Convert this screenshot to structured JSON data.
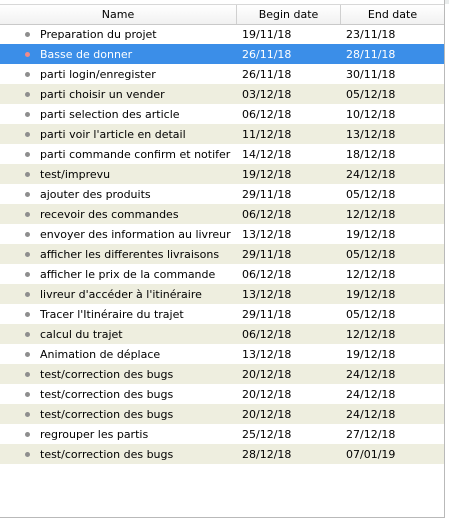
{
  "columns": {
    "name": "Name",
    "begin": "Begin date",
    "end": "End date"
  },
  "rows": [
    {
      "name": "Preparation du projet",
      "begin": "19/11/18",
      "end": "23/11/18"
    },
    {
      "name": "Basse de donner",
      "begin": "26/11/18",
      "end": "28/11/18"
    },
    {
      "name": "parti login/enregister",
      "begin": "26/11/18",
      "end": "30/11/18"
    },
    {
      "name": "parti choisir un vender",
      "begin": "03/12/18",
      "end": "05/12/18"
    },
    {
      "name": "parti selection des article",
      "begin": "06/12/18",
      "end": "10/12/18"
    },
    {
      "name": "parti voir l'article en detail",
      "begin": "11/12/18",
      "end": "13/12/18"
    },
    {
      "name": "parti commande confirm et notifer",
      "begin": "14/12/18",
      "end": "18/12/18"
    },
    {
      "name": "test/imprevu",
      "begin": "19/12/18",
      "end": "24/12/18"
    },
    {
      "name": "ajouter des produits",
      "begin": "29/11/18",
      "end": "05/12/18"
    },
    {
      "name": "recevoir des commandes",
      "begin": "06/12/18",
      "end": "12/12/18"
    },
    {
      "name": "envoyer des information au livreur",
      "begin": "13/12/18",
      "end": "19/12/18"
    },
    {
      "name": "afficher les differentes livraisons",
      "begin": "29/11/18",
      "end": "05/12/18"
    },
    {
      "name": "afficher le prix de la commande",
      "begin": "06/12/18",
      "end": "12/12/18"
    },
    {
      "name": "livreur d'accéder à l'itinéraire",
      "begin": "13/12/18",
      "end": "19/12/18"
    },
    {
      "name": "Tracer l'Itinéraire du trajet",
      "begin": "29/11/18",
      "end": "05/12/18"
    },
    {
      "name": "calcul du trajet",
      "begin": "06/12/18",
      "end": "12/12/18"
    },
    {
      "name": "Animation de déplace",
      "begin": "13/12/18",
      "end": "19/12/18"
    },
    {
      "name": "test/correction des bugs",
      "begin": "20/12/18",
      "end": "24/12/18"
    },
    {
      "name": "test/correction des bugs",
      "begin": "20/12/18",
      "end": "24/12/18"
    },
    {
      "name": "test/correction des bugs",
      "begin": "20/12/18",
      "end": "24/12/18"
    },
    {
      "name": "regrouper les partis",
      "begin": "25/12/18",
      "end": "27/12/18"
    },
    {
      "name": "test/correction des bugs",
      "begin": "28/12/18",
      "end": "07/01/19"
    }
  ],
  "selected_row": 1,
  "colors": {
    "selection": "#3b8ee8",
    "alt_row": "#eeeedf"
  }
}
